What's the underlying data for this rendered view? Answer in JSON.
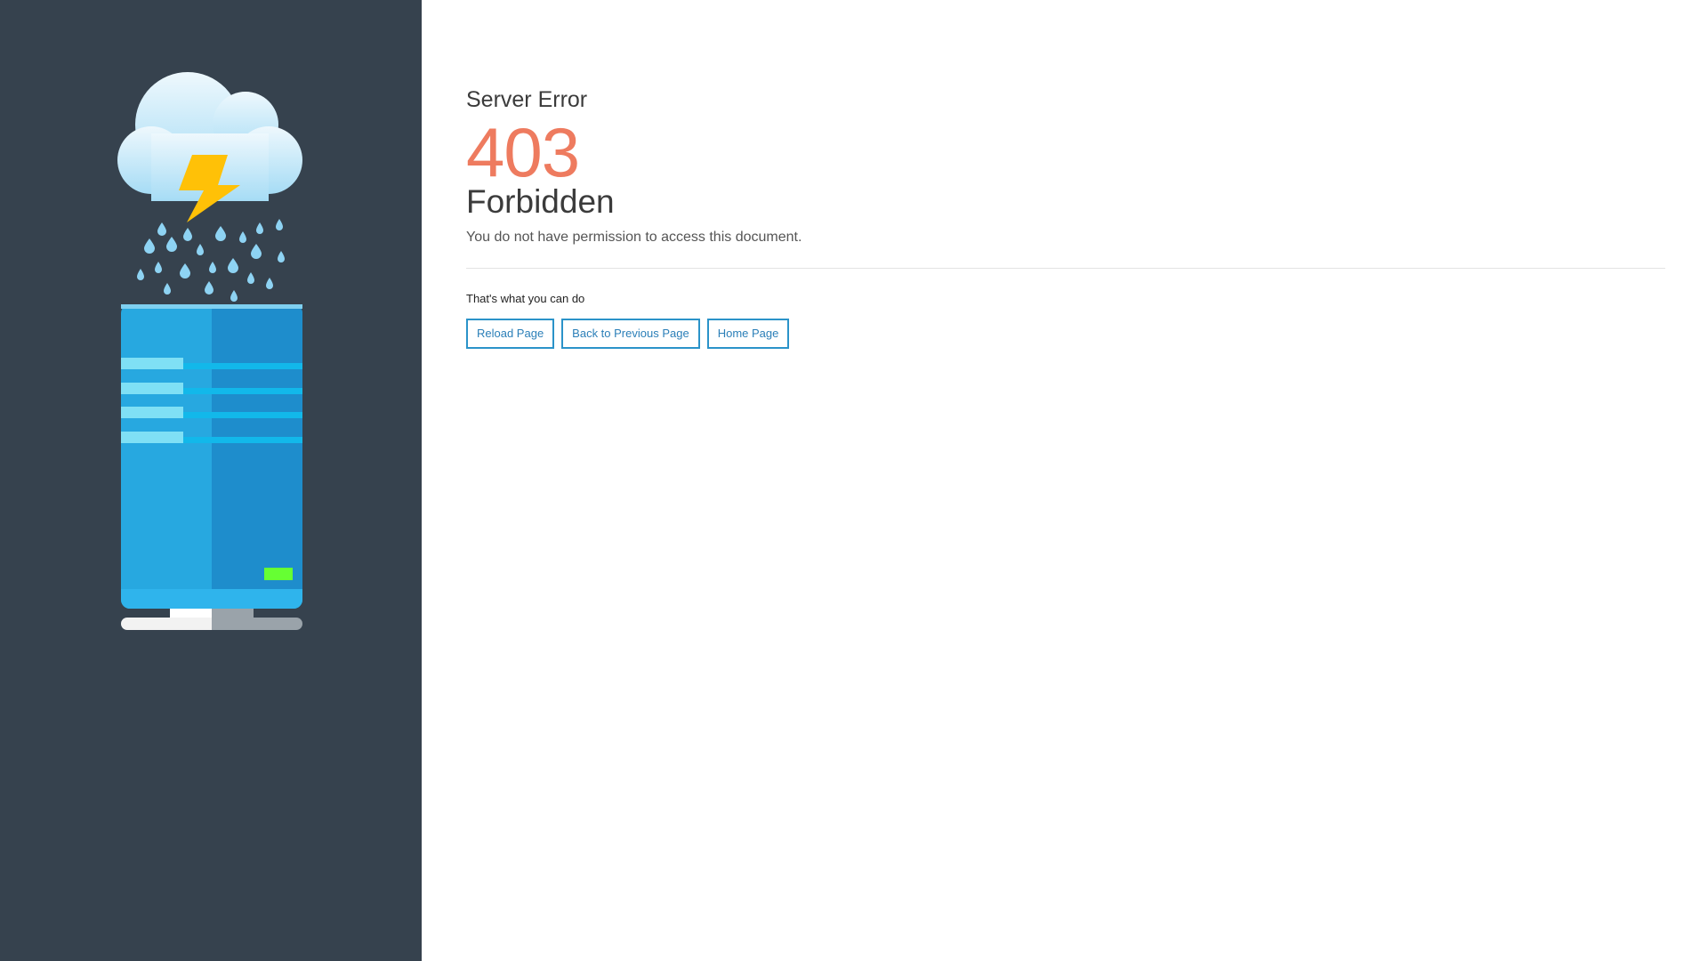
{
  "error": {
    "subtitle": "Server Error",
    "code": "403",
    "title": "Forbidden",
    "description": "You do not have permission to access this document."
  },
  "actions": {
    "heading": "That's what you can do",
    "buttons": [
      {
        "label": "Reload Page"
      },
      {
        "label": "Back to Previous Page"
      },
      {
        "label": "Home Page"
      }
    ]
  },
  "colors": {
    "sidebar": "#36424e",
    "code": "#ee7b5f",
    "button_border": "#2b93c9",
    "server_light": "#27a8e0",
    "server_dark": "#1e8dcc",
    "indicator": "#66ff33",
    "bolt": "#ffc107"
  },
  "icons": {
    "illustration": "cloud-lightning-server-illustration"
  }
}
